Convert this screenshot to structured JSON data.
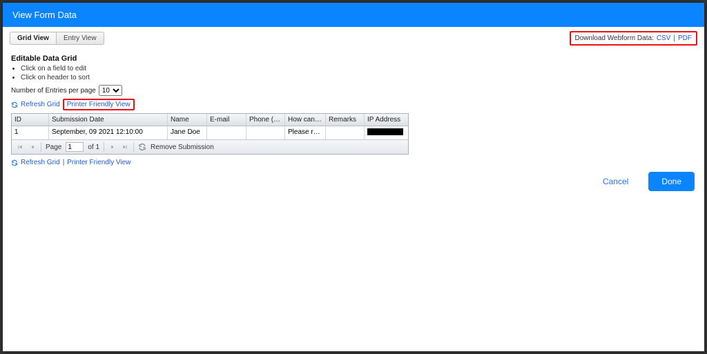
{
  "header": {
    "title": "View Form Data"
  },
  "tabs": {
    "grid": "Grid View",
    "entry": "Entry View"
  },
  "download": {
    "label": "Download Webform Data:",
    "csv": "CSV",
    "pdf": "PDF"
  },
  "grid_title": "Editable Data Grid",
  "hints": {
    "edit": "Click on a field to edit",
    "sort": "Click on header to sort"
  },
  "per_page": {
    "label": "Number of Entries per page",
    "value": "10"
  },
  "links": {
    "refresh": "Refresh Grid",
    "printer": "Printer Friendly View"
  },
  "columns": {
    "id": "ID",
    "submission": "Submission Date",
    "name": "Name",
    "email": "E-mail",
    "phone": "Phone (Optional)",
    "how": "How can we help",
    "remarks": "Remarks",
    "ip": "IP Address"
  },
  "rows": [
    {
      "id": "1",
      "submission": "September, 09 2021 12:10:00",
      "name": "Jane Doe",
      "email": "",
      "phone": "",
      "how": "Please reach …",
      "remarks": ""
    }
  ],
  "pager": {
    "page_label": "Page",
    "page_value": "1",
    "of_label": "of 1",
    "remove": "Remove Submission"
  },
  "footer": {
    "cancel": "Cancel",
    "done": "Done"
  }
}
